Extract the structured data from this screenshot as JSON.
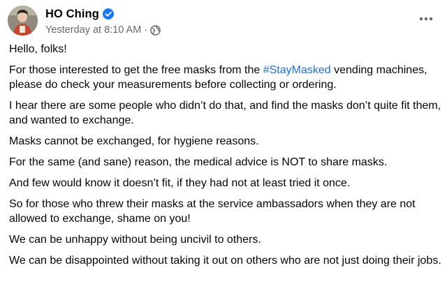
{
  "post": {
    "author": "HO Ching",
    "timestamp": "Yesterday at 8:10 AM",
    "meta_separator": "·",
    "audience_icon": "globe-icon",
    "verified_icon": "verified-badge-icon",
    "more_icon": "more-options-icon",
    "colors": {
      "hashtag": "#216fdb",
      "verified": "#1877f2",
      "meta_text": "#65676b"
    },
    "body": {
      "p1": "Hello, folks!",
      "p2_before": "For those interested to get the free masks from the ",
      "p2_hashtag": "#StayMasked",
      "p2_after": " vending machines, please do check your measurements before collecting or ordering.",
      "p3": "I hear there are some people who didn’t do that, and find the masks don’t quite fit them, and wanted to exchange.",
      "p4": "Masks cannot be exchanged, for hygiene reasons.",
      "p5": "For the same (and sane) reason, the medical advice is NOT to share masks.",
      "p6": "And few would know it doesn’t fit, if they had not at least tried it once.",
      "p7": "So for those who threw their masks at the service ambassadors when they are not allowed to exchange, shame on you!",
      "p8": "We can be unhappy without being uncivil to others.",
      "p9": "We can be disappointed without taking it out on others who are not just doing their jobs."
    }
  }
}
